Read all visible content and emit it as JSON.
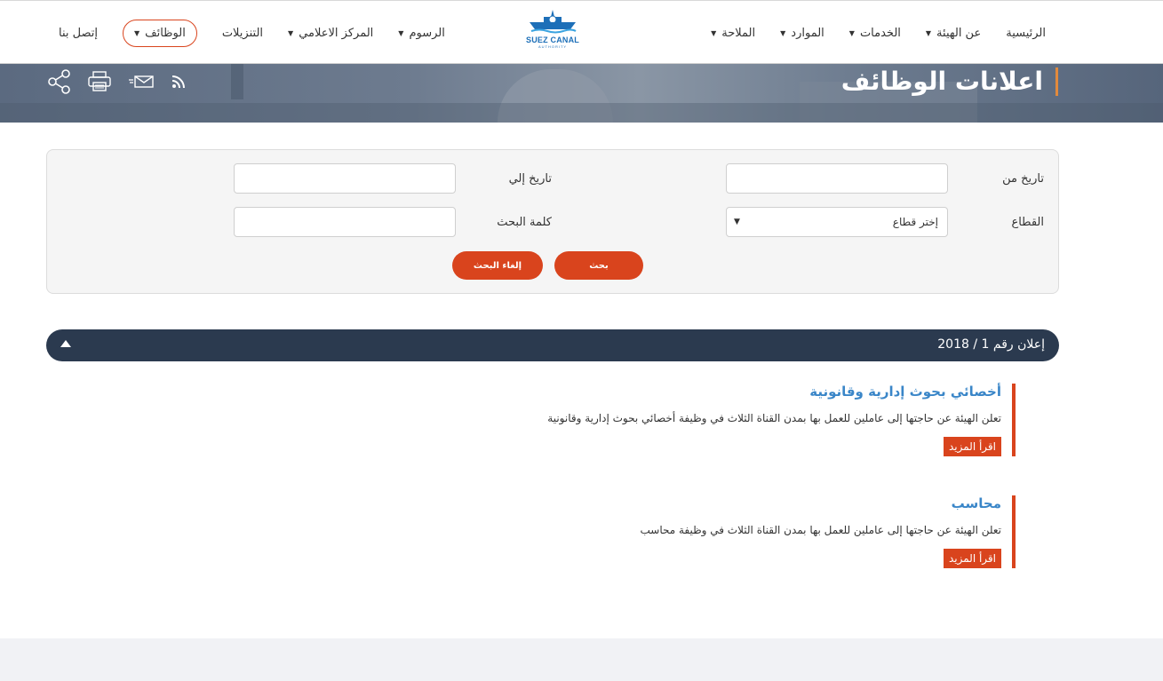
{
  "nav": {
    "right_items": [
      {
        "label": "الرئيسية",
        "caret": false
      },
      {
        "label": "عن الهيئة",
        "caret": true
      },
      {
        "label": "الخدمات",
        "caret": true
      },
      {
        "label": "الموارد",
        "caret": true
      },
      {
        "label": "الملاحة",
        "caret": true
      }
    ],
    "left_items": [
      {
        "label": "الرسوم",
        "caret": true
      },
      {
        "label": "المركز الاعلامي",
        "caret": true
      },
      {
        "label": "التنزيلات",
        "caret": false
      },
      {
        "label": "الوظائف",
        "caret": true,
        "active": true
      },
      {
        "label": "إتصل بنا",
        "caret": false
      }
    ],
    "logo_text": "SUEZ CANAL",
    "logo_sub": "AUTHORITY"
  },
  "banner": {
    "title": "اعلانات الوظائف",
    "tools": [
      "share-icon",
      "print-icon",
      "mail-icon",
      "rss-icon"
    ]
  },
  "search": {
    "date_from_label": "تاريخ من",
    "date_to_label": "تاريخ إلي",
    "sector_label": "القطاع",
    "sector_value": "إختر قطاع",
    "keyword_label": "كلمة البحث",
    "search_button": "بحث",
    "cancel_button": "إلغاء البحث"
  },
  "announcement": {
    "title": "إعلان رقم 1 / 2018",
    "jobs": [
      {
        "title": "أخصائي بحوث إدارية وقانونية",
        "description": "تعلن الهيئة عن حاجتها إلى عاملين للعمل بها بمدن القناة الثلاث في وظيفة أخصائي بحوث إدارية وقانونية",
        "more": "اقرأ المزيد"
      },
      {
        "title": "محاسب",
        "description": "تعلن الهيئة عن حاجتها إلى عاملين للعمل بها بمدن القناة الثلاث في وظيفة محاسب",
        "more": "اقرأ المزيد"
      }
    ]
  },
  "colors": {
    "accent": "#d9441d",
    "navy": "#2b3a4f",
    "link": "#3a86c8"
  }
}
